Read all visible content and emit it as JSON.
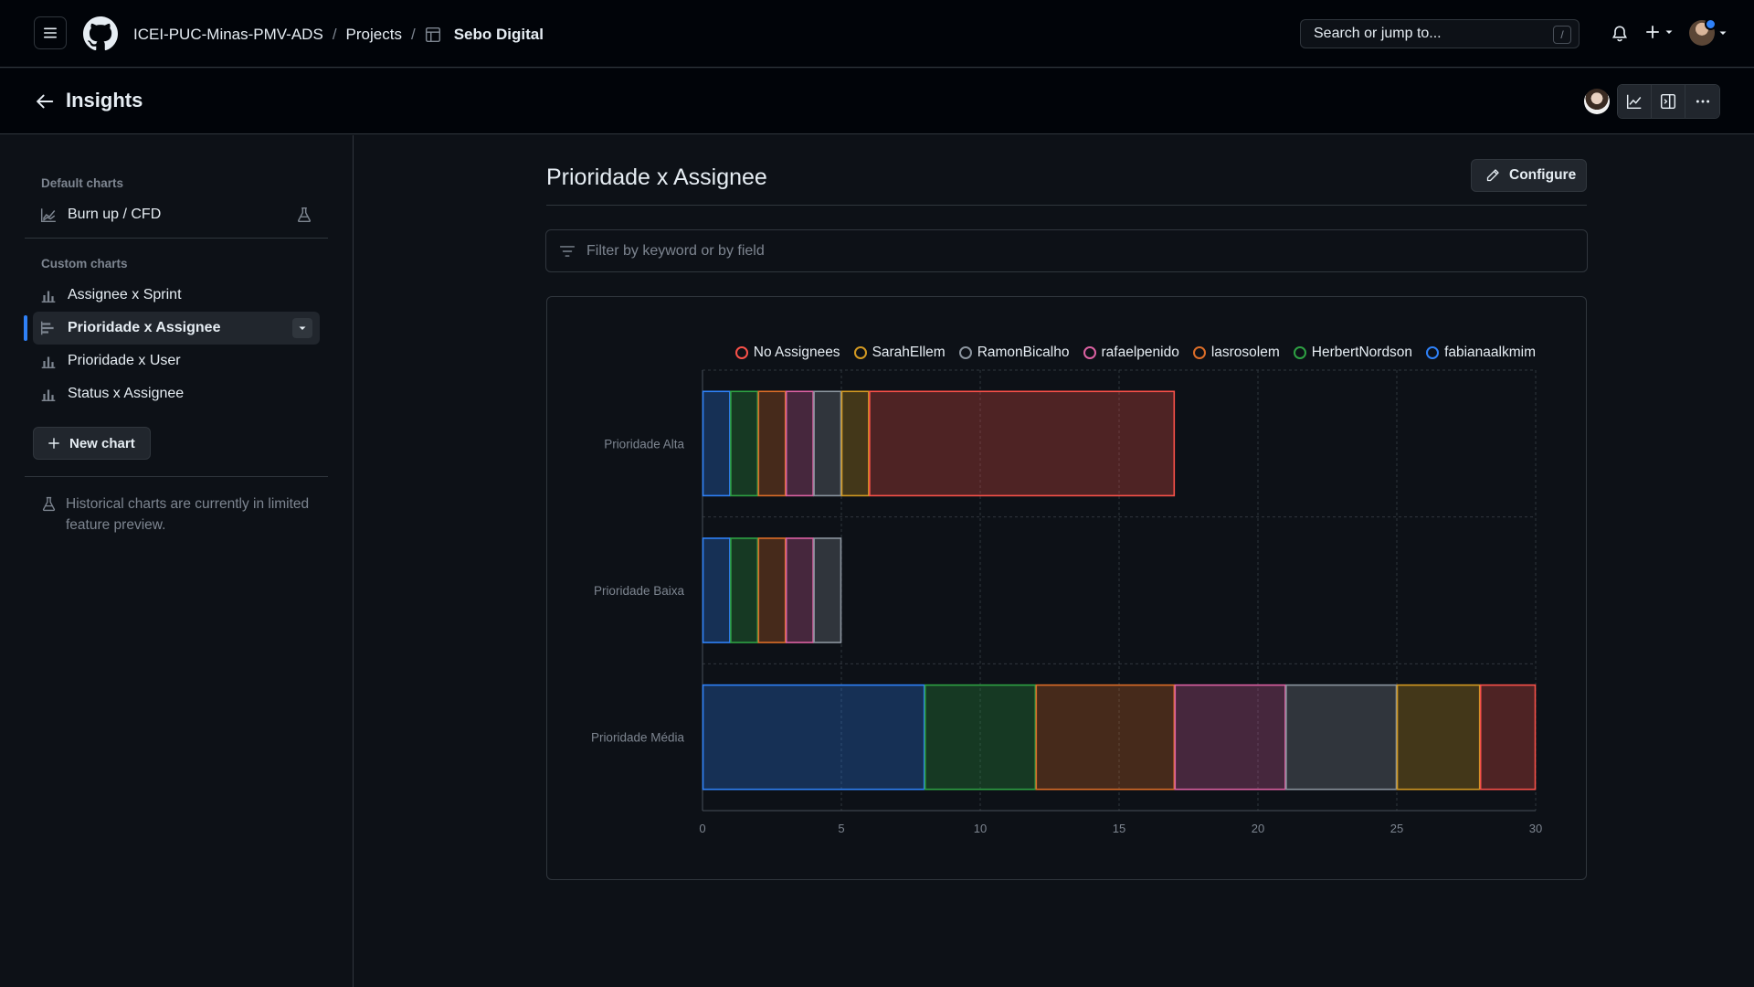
{
  "header": {
    "breadcrumb": {
      "org": "ICEI-PUC-Minas-PMV-ADS",
      "sep1": "/",
      "projects": "Projects",
      "sep2": "/",
      "project": "Sebo Digital"
    },
    "search_placeholder": "Search or jump to...",
    "search_shortcut": "/"
  },
  "subheader": {
    "title": "Insights"
  },
  "sidebar": {
    "default_heading": "Default charts",
    "default_items": [
      {
        "label": "Burn up / CFD"
      }
    ],
    "custom_heading": "Custom charts",
    "custom_items": [
      {
        "label": "Assignee x Sprint"
      },
      {
        "label": "Prioridade x Assignee",
        "active": true
      },
      {
        "label": "Prioridade x User"
      },
      {
        "label": "Status x Assignee"
      }
    ],
    "new_chart_label": "New chart",
    "preview_note": "Historical charts are currently in limited feature preview."
  },
  "main": {
    "title": "Prioridade x Assignee",
    "configure_label": "Configure",
    "filter_placeholder": "Filter by keyword or by field"
  },
  "colors": {
    "accent": "#2f81f7",
    "background": "#0d1117",
    "border": "#30363d"
  },
  "chart_data": {
    "type": "bar",
    "orientation": "horizontal",
    "stacked": true,
    "categories": [
      "Prioridade Alta",
      "Prioridade Baixa",
      "Prioridade Média"
    ],
    "series": [
      {
        "name": "fabianaalkmim",
        "color": "#2f81f7",
        "values": [
          1,
          1,
          8
        ]
      },
      {
        "name": "HerbertNordson",
        "color": "#2ea043",
        "values": [
          1,
          1,
          4
        ]
      },
      {
        "name": "lasrosolem",
        "color": "#db6d28",
        "values": [
          1,
          1,
          5
        ]
      },
      {
        "name": "rafaelpenido",
        "color": "#db61a2",
        "values": [
          1,
          1,
          4
        ]
      },
      {
        "name": "RamonBicalho",
        "color": "#8b949e",
        "values": [
          1,
          1,
          4
        ]
      },
      {
        "name": "SarahEllem",
        "color": "#d29922",
        "values": [
          1,
          0,
          3
        ]
      },
      {
        "name": "No Assignees",
        "color": "#f85149",
        "values": [
          11,
          0,
          2
        ]
      }
    ],
    "legend_order": [
      "No Assignees",
      "SarahEllem",
      "RamonBicalho",
      "rafaelpenido",
      "lasrosolem",
      "HerbertNordson",
      "fabianaalkmim"
    ],
    "xlim": [
      0,
      30
    ],
    "xticks": [
      0,
      5,
      10,
      15,
      20,
      25,
      30
    ],
    "grid": true,
    "legend_position": "top-right"
  }
}
